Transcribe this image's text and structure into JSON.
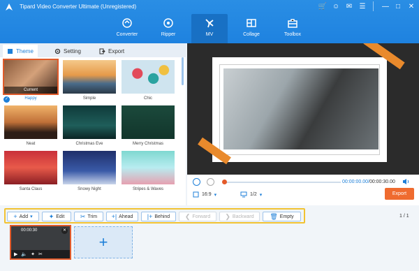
{
  "app": {
    "title": "Tipard Video Converter Ultimate (Unregistered)",
    "accent": "#1e82e0",
    "export_color": "#ef6b2f"
  },
  "nav": [
    {
      "label": "Converter",
      "icon": "converter-icon"
    },
    {
      "label": "Ripper",
      "icon": "ripper-icon"
    },
    {
      "label": "MV",
      "icon": "mv-icon",
      "active": true
    },
    {
      "label": "Collage",
      "icon": "collage-icon"
    },
    {
      "label": "Toolbox",
      "icon": "toolbox-icon"
    }
  ],
  "tabs": {
    "theme": "Theme",
    "setting": "Setting",
    "export": "Export"
  },
  "themes": [
    {
      "name": "Happy",
      "badge": "Current",
      "selected": true
    },
    {
      "name": "Simple"
    },
    {
      "name": "Chic"
    },
    {
      "name": "Neat"
    },
    {
      "name": "Christmas Eve"
    },
    {
      "name": "Merry Christmas"
    },
    {
      "name": "Santa Claus"
    },
    {
      "name": "Snowy Night"
    },
    {
      "name": "Stripes & Waves"
    }
  ],
  "player": {
    "time_current": "00:00:00.00",
    "time_total": "00:00:30.00",
    "aspect_ratio": "16:9",
    "page": "1/2",
    "export_label": "Export"
  },
  "toolbar": {
    "add": "Add",
    "edit": "Edit",
    "trim": "Trim",
    "ahead": "Ahead",
    "behind": "Behind",
    "forward": "Forward",
    "backward": "Backward",
    "empty": "Empty",
    "page_count": "1 / 1"
  },
  "clip": {
    "duration": "00:00:30"
  }
}
